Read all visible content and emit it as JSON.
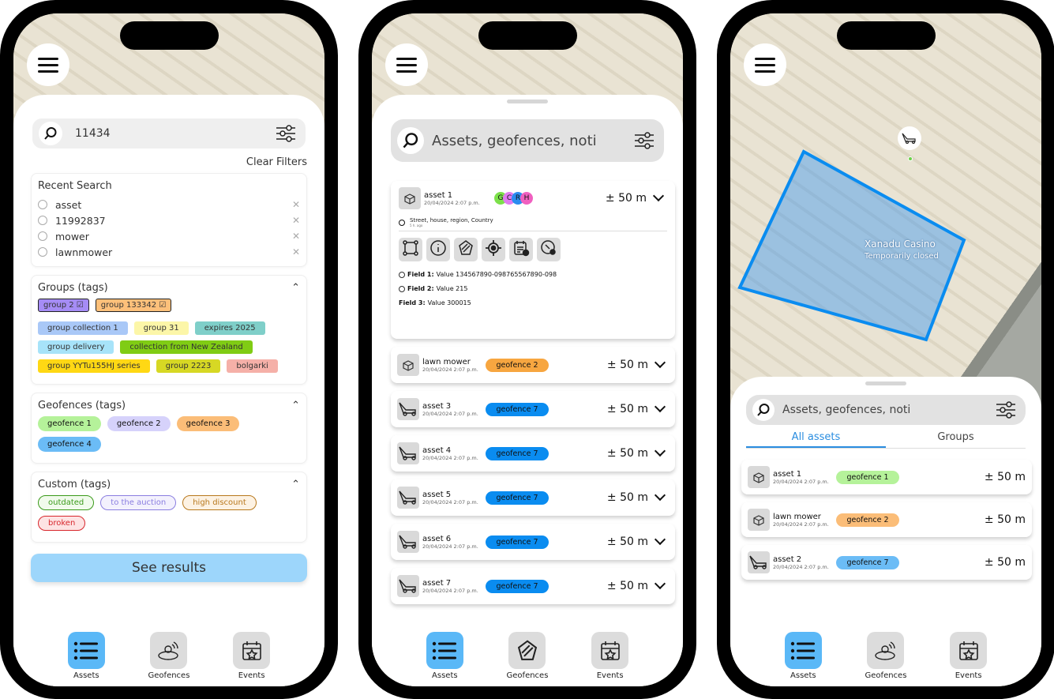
{
  "colors": {
    "accent": "#5ab8f7",
    "geofence_blue": "#0a8cf0",
    "tab_active": "#2a8de0"
  },
  "nav": [
    {
      "label": "Assets",
      "icon": "list-icon"
    },
    {
      "label": "Geofences",
      "icon": "geofence-icon"
    },
    {
      "label": "Events",
      "icon": "calendar-star-icon"
    }
  ],
  "phone1": {
    "search_value": "11434",
    "clear_filters": "Clear Filters",
    "recent_title": "Recent Search",
    "recent": [
      "asset",
      "11992837",
      "mower",
      "lawnmower"
    ],
    "groups_title": "Groups (tags)",
    "selected_groups": [
      {
        "label": "group 2",
        "color": "#a58cf5"
      },
      {
        "label": "group 133342",
        "color": "#fdc07a"
      }
    ],
    "groups": [
      {
        "label": "group collection 1",
        "color": "#a9c8f7"
      },
      {
        "label": "group 31",
        "color": "#fcf6a8"
      },
      {
        "label": "expires 2025",
        "color": "#7fcfc9"
      },
      {
        "label": "group delivery",
        "color": "#a7e3f9"
      },
      {
        "label": "collection from New Zealand",
        "color": "#80cc14"
      },
      {
        "label": "group YYTu155HJ series",
        "color": "#ffd814"
      },
      {
        "label": "group 2223",
        "color": "#d7d824"
      },
      {
        "label": "bolgarki",
        "color": "#f5b0a8"
      }
    ],
    "geofences_title": "Geofences (tags)",
    "geofences": [
      {
        "label": "geofence 1",
        "color": "#b5f29a"
      },
      {
        "label": "geofence 2",
        "color": "#d6d2fb"
      },
      {
        "label": "geofence 3",
        "color": "#fbbd78"
      },
      {
        "label": "geofence 4",
        "color": "#6bbcf6"
      }
    ],
    "custom_title": "Custom (tags)",
    "custom": [
      {
        "label": "outdated",
        "color": "#3a9a1a",
        "bg": "#f1fbec"
      },
      {
        "label": "to the auction",
        "color": "#8a7ee0",
        "bg": "#f3f1fd"
      },
      {
        "label": "high discount",
        "color": "#b8781c",
        "bg": "#fdf2e3"
      },
      {
        "label": "broken",
        "color": "#d8262c",
        "bg": "#fde3e3"
      }
    ],
    "see_results": "See results"
  },
  "phone2": {
    "search_placeholder": "Assets, geofences, noti",
    "expanded": {
      "name": "asset 1",
      "date": "20/04/2024 2:07 p.m.",
      "avatars": [
        {
          "l": "G",
          "c": "#7ce04a"
        },
        {
          "l": "C",
          "c": "#e07cf0"
        },
        {
          "l": "R",
          "c": "#2a8cf0"
        },
        {
          "l": "H",
          "c": "#f060c0"
        }
      ],
      "distance": "± 50 m",
      "address": "Street, house, region, Country",
      "address_time": "5 h. ago",
      "actions": [
        "route-icon",
        "info-icon",
        "geofence-icon",
        "locate-icon",
        "calendar-clock-icon",
        "maintenance-icon"
      ],
      "fields": [
        {
          "label": "Field 1:",
          "value": "Value 134567890-098765567890-098",
          "icon": "alarm-icon"
        },
        {
          "label": "Field 2:",
          "value": "Value 215",
          "icon": "timer-icon"
        },
        {
          "label": "Field 3:",
          "value": "Value 300015",
          "icon": ""
        }
      ]
    },
    "assets": [
      {
        "name": "lawn mower",
        "date": "20/04/2024 2:07 p.m.",
        "geofence": "geofence 2",
        "color": "#f7a640",
        "icon": "box"
      },
      {
        "name": "asset 3",
        "date": "20/04/2024 2:07 p.m.",
        "geofence": "geofence 7",
        "color": "#0a8cf0",
        "icon": "mower"
      },
      {
        "name": "asset 4",
        "date": "20/04/2024 2:07 p.m.",
        "geofence": "geofence 7",
        "color": "#0a8cf0",
        "icon": "mower"
      },
      {
        "name": "asset 5",
        "date": "20/04/2024 2:07 p.m.",
        "geofence": "geofence 7",
        "color": "#0a8cf0",
        "icon": "mower"
      },
      {
        "name": "asset 6",
        "date": "20/04/2024 2:07 p.m.",
        "geofence": "geofence 7",
        "color": "#0a8cf0",
        "icon": "mower"
      },
      {
        "name": "asset 7",
        "date": "20/04/2024 2:07 p.m.",
        "geofence": "geofence 7",
        "color": "#0a8cf0",
        "icon": "mower"
      }
    ],
    "distance": "± 50 m"
  },
  "phone3": {
    "map_label": "Xanadu Casino",
    "map_sublabel": "Temporarily closed",
    "search_placeholder": "Assets, geofences, noti",
    "tabs": [
      "All assets",
      "Groups"
    ],
    "assets": [
      {
        "name": "asset 1",
        "date": "20/04/2024 2:07 p.m.",
        "geofence": "geofence 1",
        "color": "#b5f29a",
        "icon": "box"
      },
      {
        "name": "lawn mower",
        "date": "20/04/2024 2:07 p.m.",
        "geofence": "geofence 2",
        "color": "#fbbd78",
        "icon": "box"
      },
      {
        "name": "asset 2",
        "date": "20/04/2024 2:07 p.m.",
        "geofence": "geofence 7",
        "color": "#6bbcf6",
        "icon": "mower"
      }
    ],
    "distance": "± 50 m"
  }
}
